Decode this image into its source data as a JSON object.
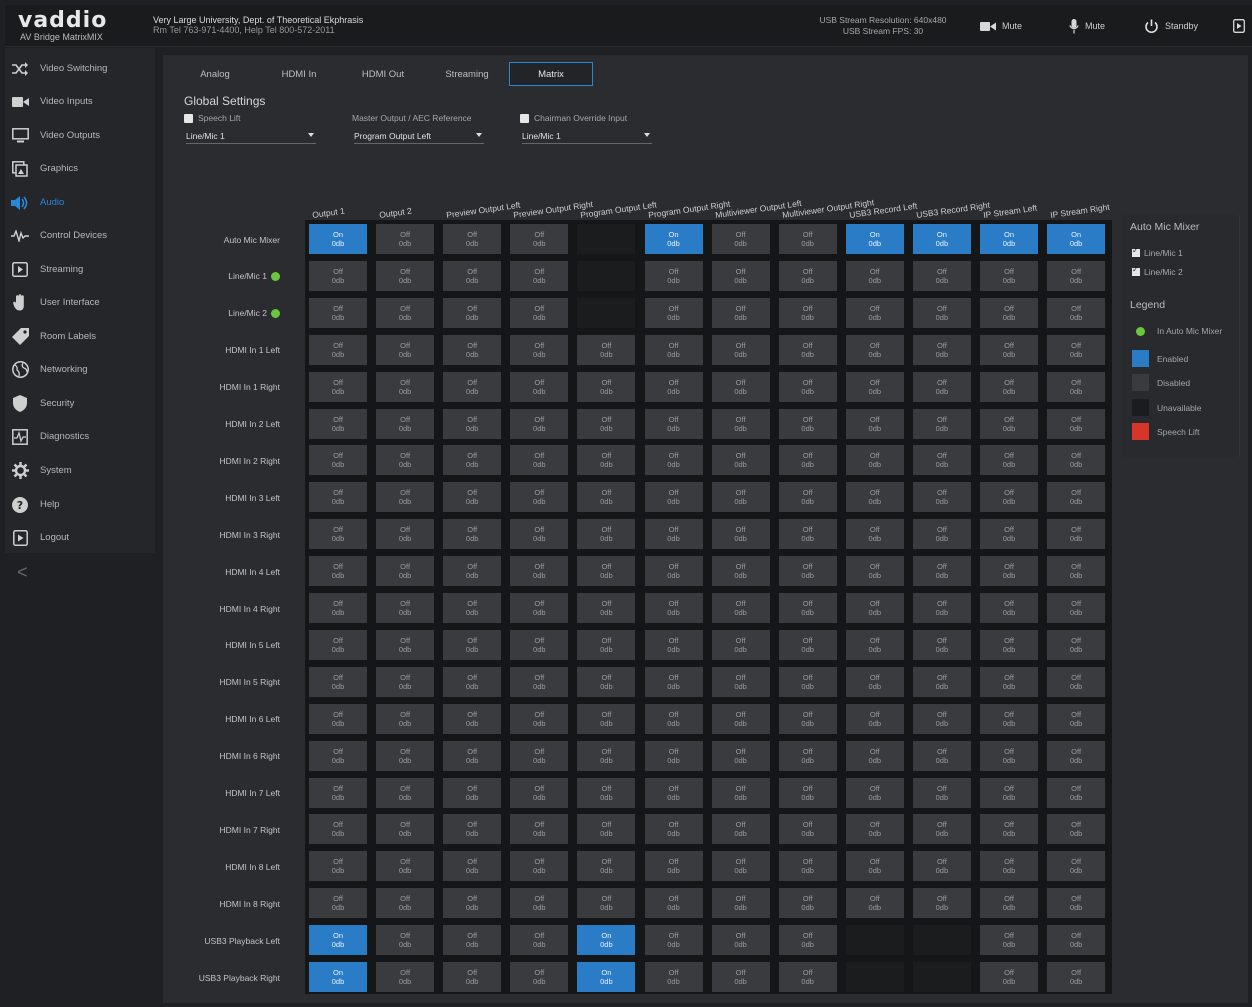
{
  "header": {
    "logo": "vaddio",
    "product": "AV Bridge MatrixMIX",
    "org_line1": "Very Large University, Dept. of Theoretical Ekphrasis",
    "org_line2": "Rm Tel 763-971-4400, Help Tel 800-572-2011",
    "usb_resolution": "USB Stream Resolution: 640x480",
    "usb_fps": "USB Stream FPS: 30",
    "video_mute_label": "Mute",
    "audio_mute_label": "Mute",
    "standby_label": "Standby"
  },
  "sidebar": {
    "items": [
      {
        "label": "Video Switching",
        "icon": "shuffle-icon",
        "active": false
      },
      {
        "label": "Video Inputs",
        "icon": "camera-icon",
        "active": false
      },
      {
        "label": "Video Outputs",
        "icon": "monitor-icon",
        "active": false
      },
      {
        "label": "Graphics",
        "icon": "graphics-icon",
        "active": false
      },
      {
        "label": "Audio",
        "icon": "speaker-icon",
        "active": true
      },
      {
        "label": "Control Devices",
        "icon": "control-icon",
        "active": false
      },
      {
        "label": "Streaming",
        "icon": "play-icon",
        "active": false
      },
      {
        "label": "User Interface",
        "icon": "hand-icon",
        "active": false
      },
      {
        "label": "Room Labels",
        "icon": "tag-icon",
        "active": false
      },
      {
        "label": "Networking",
        "icon": "globe-icon",
        "active": false
      },
      {
        "label": "Security",
        "icon": "shield-icon",
        "active": false
      },
      {
        "label": "Diagnostics",
        "icon": "pulse-icon",
        "active": false
      },
      {
        "label": "System",
        "icon": "gear-icon",
        "active": false
      },
      {
        "label": "Help",
        "icon": "help-icon",
        "active": false
      },
      {
        "label": "Logout",
        "icon": "logout-icon",
        "active": false
      }
    ],
    "collapse_glyph": "<"
  },
  "tabs": [
    "Analog",
    "HDMI In",
    "HDMI Out",
    "Streaming",
    "Matrix"
  ],
  "active_tab": "Matrix",
  "global_settings": {
    "title": "Global Settings",
    "speech_lift_label": "Speech Lift",
    "speech_lift_value": "Line/Mic 1",
    "master_output_label": "Master Output / AEC Reference",
    "master_output_value": "Program Output Left",
    "chairman_label": "Chairman Override Input",
    "chairman_value": "Line/Mic 1"
  },
  "columns": [
    "Output 1",
    "Output 2",
    "Preview Output Left",
    "Preview Output Right",
    "Program Output Left",
    "Program Output Right",
    "Multiviewer Output Left",
    "Multiviewer Output Right",
    "USB3 Record Left",
    "USB3 Record Right",
    "IP Stream Left",
    "IP Stream Right"
  ],
  "rows": [
    {
      "label": "Auto Mic Mixer",
      "dot": false,
      "cells": [
        "on",
        "off",
        "off",
        "off",
        "na",
        "on",
        "off",
        "off",
        "on",
        "on",
        "on",
        "on"
      ]
    },
    {
      "label": "Line/Mic 1",
      "dot": true,
      "cells": [
        "off",
        "off",
        "off",
        "off",
        "na",
        "off",
        "off",
        "off",
        "off",
        "off",
        "off",
        "off"
      ]
    },
    {
      "label": "Line/Mic 2",
      "dot": true,
      "cells": [
        "off",
        "off",
        "off",
        "off",
        "na",
        "off",
        "off",
        "off",
        "off",
        "off",
        "off",
        "off"
      ]
    },
    {
      "label": "HDMI In 1 Left",
      "dot": false,
      "cells": [
        "off",
        "off",
        "off",
        "off",
        "off",
        "off",
        "off",
        "off",
        "off",
        "off",
        "off",
        "off"
      ]
    },
    {
      "label": "HDMI In 1 Right",
      "dot": false,
      "cells": [
        "off",
        "off",
        "off",
        "off",
        "off",
        "off",
        "off",
        "off",
        "off",
        "off",
        "off",
        "off"
      ]
    },
    {
      "label": "HDMI In 2 Left",
      "dot": false,
      "cells": [
        "off",
        "off",
        "off",
        "off",
        "off",
        "off",
        "off",
        "off",
        "off",
        "off",
        "off",
        "off"
      ]
    },
    {
      "label": "HDMI In 2 Right",
      "dot": false,
      "cells": [
        "off",
        "off",
        "off",
        "off",
        "off",
        "off",
        "off",
        "off",
        "off",
        "off",
        "off",
        "off"
      ]
    },
    {
      "label": "HDMI In 3 Left",
      "dot": false,
      "cells": [
        "off",
        "off",
        "off",
        "off",
        "off",
        "off",
        "off",
        "off",
        "off",
        "off",
        "off",
        "off"
      ]
    },
    {
      "label": "HDMI In 3 Right",
      "dot": false,
      "cells": [
        "off",
        "off",
        "off",
        "off",
        "off",
        "off",
        "off",
        "off",
        "off",
        "off",
        "off",
        "off"
      ]
    },
    {
      "label": "HDMI In 4 Left",
      "dot": false,
      "cells": [
        "off",
        "off",
        "off",
        "off",
        "off",
        "off",
        "off",
        "off",
        "off",
        "off",
        "off",
        "off"
      ]
    },
    {
      "label": "HDMI In 4 Right",
      "dot": false,
      "cells": [
        "off",
        "off",
        "off",
        "off",
        "off",
        "off",
        "off",
        "off",
        "off",
        "off",
        "off",
        "off"
      ]
    },
    {
      "label": "HDMI In 5 Left",
      "dot": false,
      "cells": [
        "off",
        "off",
        "off",
        "off",
        "off",
        "off",
        "off",
        "off",
        "off",
        "off",
        "off",
        "off"
      ]
    },
    {
      "label": "HDMI In 5 Right",
      "dot": false,
      "cells": [
        "off",
        "off",
        "off",
        "off",
        "off",
        "off",
        "off",
        "off",
        "off",
        "off",
        "off",
        "off"
      ]
    },
    {
      "label": "HDMI In 6 Left",
      "dot": false,
      "cells": [
        "off",
        "off",
        "off",
        "off",
        "off",
        "off",
        "off",
        "off",
        "off",
        "off",
        "off",
        "off"
      ]
    },
    {
      "label": "HDMI In 6 Right",
      "dot": false,
      "cells": [
        "off",
        "off",
        "off",
        "off",
        "off",
        "off",
        "off",
        "off",
        "off",
        "off",
        "off",
        "off"
      ]
    },
    {
      "label": "HDMI In 7 Left",
      "dot": false,
      "cells": [
        "off",
        "off",
        "off",
        "off",
        "off",
        "off",
        "off",
        "off",
        "off",
        "off",
        "off",
        "off"
      ]
    },
    {
      "label": "HDMI In 7 Right",
      "dot": false,
      "cells": [
        "off",
        "off",
        "off",
        "off",
        "off",
        "off",
        "off",
        "off",
        "off",
        "off",
        "off",
        "off"
      ]
    },
    {
      "label": "HDMI In 8 Left",
      "dot": false,
      "cells": [
        "off",
        "off",
        "off",
        "off",
        "off",
        "off",
        "off",
        "off",
        "off",
        "off",
        "off",
        "off"
      ]
    },
    {
      "label": "HDMI In 8 Right",
      "dot": false,
      "cells": [
        "off",
        "off",
        "off",
        "off",
        "off",
        "off",
        "off",
        "off",
        "off",
        "off",
        "off",
        "off"
      ]
    },
    {
      "label": "USB3 Playback Left",
      "dot": false,
      "cells": [
        "on",
        "off",
        "off",
        "off",
        "on",
        "off",
        "off",
        "off",
        "na",
        "na",
        "off",
        "off"
      ]
    },
    {
      "label": "USB3 Playback Right",
      "dot": false,
      "cells": [
        "on",
        "off",
        "off",
        "off",
        "on",
        "off",
        "off",
        "off",
        "na",
        "na",
        "off",
        "off"
      ]
    }
  ],
  "cell_text": {
    "on": "On",
    "off": "Off",
    "db": "0db"
  },
  "auto_mic_mixer": {
    "title": "Auto Mic Mixer",
    "items": [
      "Line/Mic 1",
      "Line/Mic 2"
    ]
  },
  "legend": {
    "title": "Legend",
    "items": [
      {
        "label": "In Auto Mic Mixer",
        "color": "#6cc63c",
        "shape": "dot"
      },
      {
        "label": "Enabled",
        "color": "#2a7cc7",
        "shape": "square"
      },
      {
        "label": "Disabled",
        "color": "#3a3b3f",
        "shape": "square"
      },
      {
        "label": "Unavailable",
        "color": "#1b1c1e",
        "shape": "square"
      },
      {
        "label": "Speech Lift",
        "color": "#d8352a",
        "shape": "square"
      }
    ]
  },
  "colors": {
    "accent": "#2a87d8",
    "enabled": "#2a7cc7",
    "in_mixer": "#6cc63c",
    "speech_lift": "#d8352a"
  }
}
